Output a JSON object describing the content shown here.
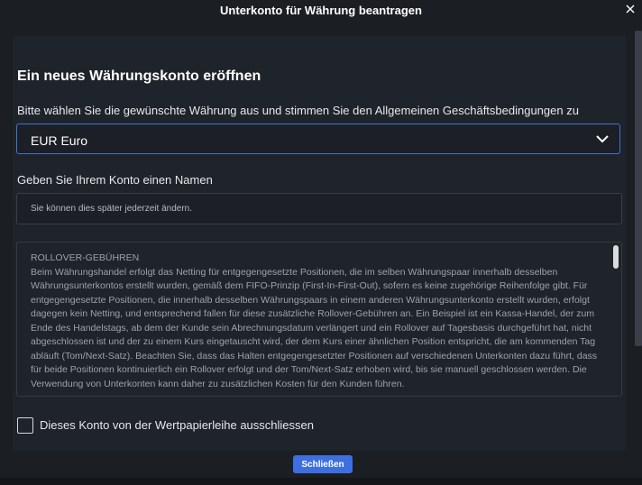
{
  "dialog": {
    "title": "Unterkonto für Währung beantragen",
    "close_icon": "close-icon"
  },
  "form": {
    "heading": "Ein neues Währungskonto eröffnen",
    "currency_instruction": "Bitte wählen Sie die gewünschte Währung aus und stimmen Sie den Allgemeinen Geschäftsbedingungen zu",
    "currency_selected": "EUR Euro",
    "name_label": "Geben Sie Ihrem Konto einen Namen",
    "name_placeholder": "Sie können dies später jederzeit ändern.",
    "name_value": ""
  },
  "terms": {
    "heading": "ROLLOVER-GEBÜHREN",
    "body": "Beim Währungshandel erfolgt das Netting für entgegengesetzte Positionen, die im selben Währungspaar innerhalb desselben Währungsunterkontos erstellt wurden, gemäß dem FIFO-Prinzip (First-In-First-Out), sofern es keine zugehörige Reihenfolge gibt. Für entgegengesetzte Positionen, die innerhalb desselben Währungspaars in einem anderen Währungsunterkonto erstellt wurden, erfolgt dagegen kein Netting, und entsprechend fallen für diese zusätzliche Rollover-Gebühren an. Ein Beispiel ist ein Kassa-Handel, der zum Ende des Handelstags, ab dem der Kunde sein Abrechnungsdatum verlängert und ein Rollover auf Tagesbasis durchgeführt hat, nicht abgeschlossen ist und der zu einem Kurs eingetauscht wird, der dem Kurs einer ähnlichen Position entspricht, die am kommenden Tag abläuft (Tom/Next-Satz). Beachten Sie, dass das Halten entgegengesetzter Positionen auf verschiedenen Unterkonten dazu führt, dass für beide Positionen kontinuierlich ein Rollover erfolgt und der Tom/Next-Satz erhoben wird, bis sie manuell geschlossen werden. Die Verwendung von Unterkonten kann daher zu zusätzlichen Kosten für den Kunden führen."
  },
  "options": {
    "exclude_lending_label": "Dieses Konto von der Wertpapierleihe ausschliessen",
    "exclude_lending_checked": false
  },
  "actions": {
    "close_label": "Schließen"
  },
  "colors": {
    "accent": "#3d6fe0",
    "background": "#1b1e23",
    "panel": "#1f232a"
  }
}
